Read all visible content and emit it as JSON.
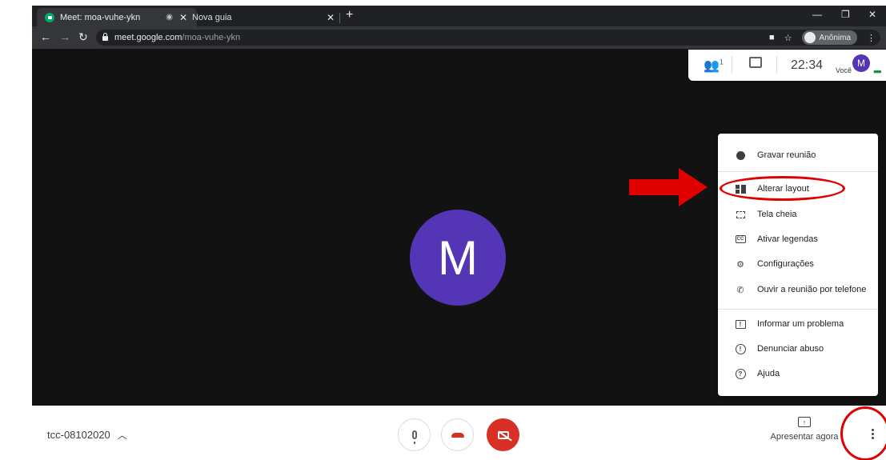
{
  "browser": {
    "tabs": [
      {
        "title": "Meet: moa-vuhe-ykn",
        "active": true
      },
      {
        "title": "Nova guia",
        "active": false
      }
    ],
    "url_host": "meet.google.com",
    "url_path": "/moa-vuhe-ykn",
    "incognito_label": "Anônima"
  },
  "meeting": {
    "participant_initial": "M",
    "participant_count": "1",
    "time": "22:34",
    "self_label": "Você",
    "self_initial": "M",
    "code": "tcc-08102020"
  },
  "menu": {
    "items": [
      {
        "label": "Gravar reunião",
        "icon": "record-icon"
      },
      {
        "label": "Alterar layout",
        "icon": "layout-icon"
      },
      {
        "label": "Tela cheia",
        "icon": "fullscreen-icon"
      },
      {
        "label": "Ativar legendas",
        "icon": "captions-icon"
      },
      {
        "label": "Configurações",
        "icon": "settings-icon"
      },
      {
        "label": "Ouvir a reunião por telefone",
        "icon": "phone-icon"
      },
      {
        "label": "Informar um problema",
        "icon": "report-problem-icon"
      },
      {
        "label": "Denunciar abuso",
        "icon": "abuse-icon"
      },
      {
        "label": "Ajuda",
        "icon": "help-icon"
      }
    ]
  },
  "controls": {
    "present_label": "Apresentar agora"
  },
  "colors": {
    "accent_red": "#d93025",
    "avatar_purple": "#5335b5",
    "annotation_red": "#e00000"
  }
}
